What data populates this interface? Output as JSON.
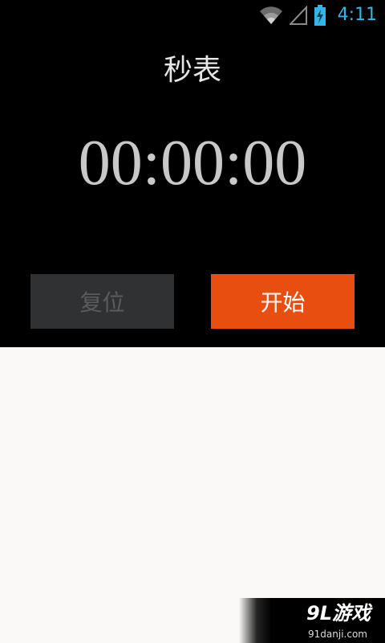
{
  "status_bar": {
    "time": "4:11",
    "icons": [
      "wifi-icon",
      "cell-signal-icon",
      "battery-charging-icon"
    ],
    "accent_color": "#33b5e5"
  },
  "app": {
    "title": "秒表",
    "timer_display": "00:00:00",
    "buttons": {
      "reset_label": "复位",
      "start_label": "开始"
    },
    "colors": {
      "start_button": "#e84e10",
      "reset_button": "#2f3133",
      "reset_text": "#5a5c5e",
      "timer_text": "#c8c8c8"
    }
  },
  "watermark": {
    "brand": "9L游戏",
    "site": "91danji.com"
  }
}
